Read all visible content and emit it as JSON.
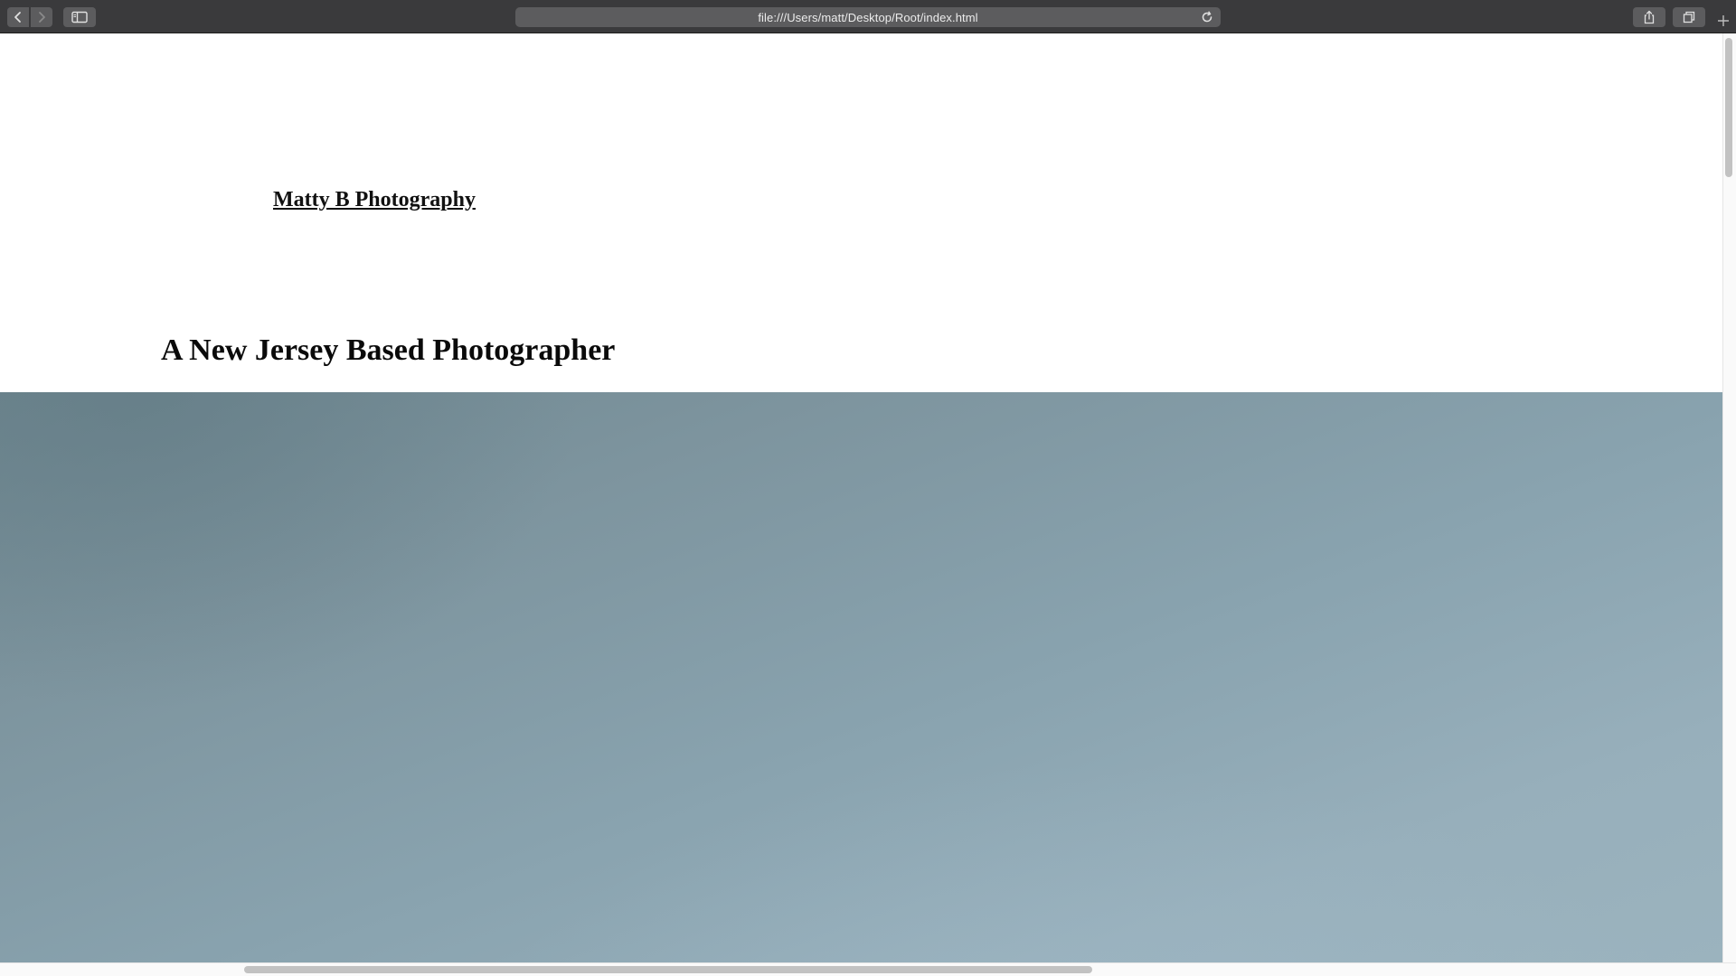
{
  "browser": {
    "url": "file:///Users/matt/Desktop/Root/index.html",
    "icons": {
      "back": "chevron-left-icon",
      "forward": "chevron-right-icon",
      "sidebar": "sidebar-icon",
      "reload": "reload-icon",
      "share": "share-icon",
      "tabs": "tabs-overview-icon",
      "new_tab": "plus-icon"
    }
  },
  "page": {
    "site_title": "Matty B Photography",
    "tagline": "A New Jersey Based Photographer"
  },
  "colors": {
    "toolbar": "#3a3a3c",
    "hero_sky": "#89a3af"
  }
}
